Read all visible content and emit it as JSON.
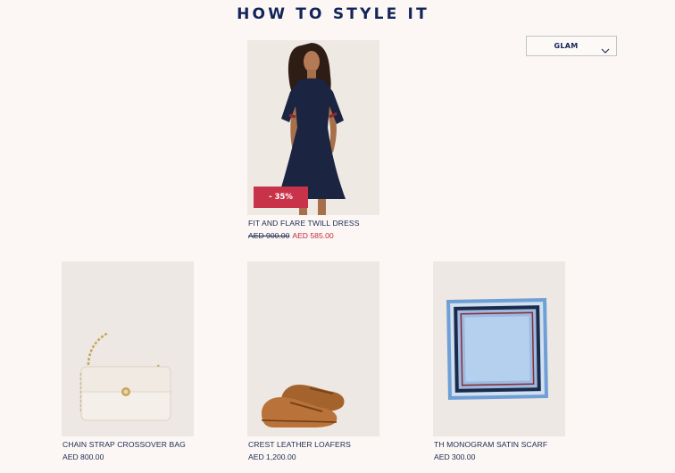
{
  "section": {
    "title": "HOW TO STYLE IT"
  },
  "style_select": {
    "selected": "GLAM"
  },
  "featured": {
    "name": "FIT AND FLARE TWILL DRESS",
    "price_original": "AED 900.00",
    "price_sale": "AED 585.00",
    "discount_badge": "- 35%"
  },
  "products": [
    {
      "name": "CHAIN STRAP CROSSOVER BAG",
      "price": "AED 800.00"
    },
    {
      "name": "CREST LEATHER LOAFERS",
      "price": "AED 1,200.00"
    },
    {
      "name": "TH MONOGRAM SATIN SCARF",
      "price": "AED 300.00"
    }
  ],
  "colors": {
    "navy": "#12245a",
    "sale_red": "#c4283d",
    "badge_red": "#c8334a",
    "background": "#fcf7f4"
  }
}
